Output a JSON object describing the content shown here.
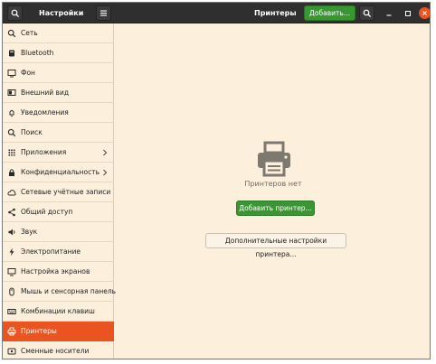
{
  "header": {
    "sidebar_title": "Настройки",
    "panel_title": "Принтеры",
    "add_button_label": "Добавить...",
    "search_icon": "search-icon",
    "menu_icon": "hamburger-menu-icon",
    "window_controls": [
      "minimize-icon",
      "maximize-icon",
      "close-icon"
    ]
  },
  "sidebar": {
    "items": [
      {
        "label": "Сеть",
        "icon": "network-icon"
      },
      {
        "label": "Bluetooth",
        "icon": "bluetooth-icon"
      },
      {
        "label": "Фон",
        "icon": "background-icon"
      },
      {
        "label": "Внешний вид",
        "icon": "appearance-icon"
      },
      {
        "label": "Уведомления",
        "icon": "notifications-icon"
      },
      {
        "label": "Поиск",
        "icon": "search-icon"
      },
      {
        "label": "Приложения",
        "icon": "apps-icon",
        "has_submenu": true
      },
      {
        "label": "Конфиденциальность",
        "icon": "privacy-icon",
        "has_submenu": true
      },
      {
        "label": "Сетевые учётные записи",
        "icon": "online-accounts-icon"
      },
      {
        "label": "Общий доступ",
        "icon": "sharing-icon"
      },
      {
        "label": "Звук",
        "icon": "sound-icon"
      },
      {
        "label": "Электропитание",
        "icon": "power-icon"
      },
      {
        "label": "Настройка экранов",
        "icon": "displays-icon"
      },
      {
        "label": "Мышь и сенсорная панель",
        "icon": "mouse-icon"
      },
      {
        "label": "Комбинации клавиш",
        "icon": "keyboard-icon"
      },
      {
        "label": "Принтеры",
        "icon": "printer-icon",
        "active": true
      },
      {
        "label": "Сменные носители",
        "icon": "removable-media-icon"
      }
    ]
  },
  "main": {
    "empty_icon": "printer-icon",
    "empty_text": "Принтеров нет",
    "add_printer_label": "Добавить принтер...",
    "advanced_label": "Дополнительные настройки принтера..."
  },
  "colors": {
    "accent": "#e95420",
    "suggested_action": "#3a9632",
    "header_bg": "#2f2f2f",
    "window_bg": "#fcf0dc"
  }
}
